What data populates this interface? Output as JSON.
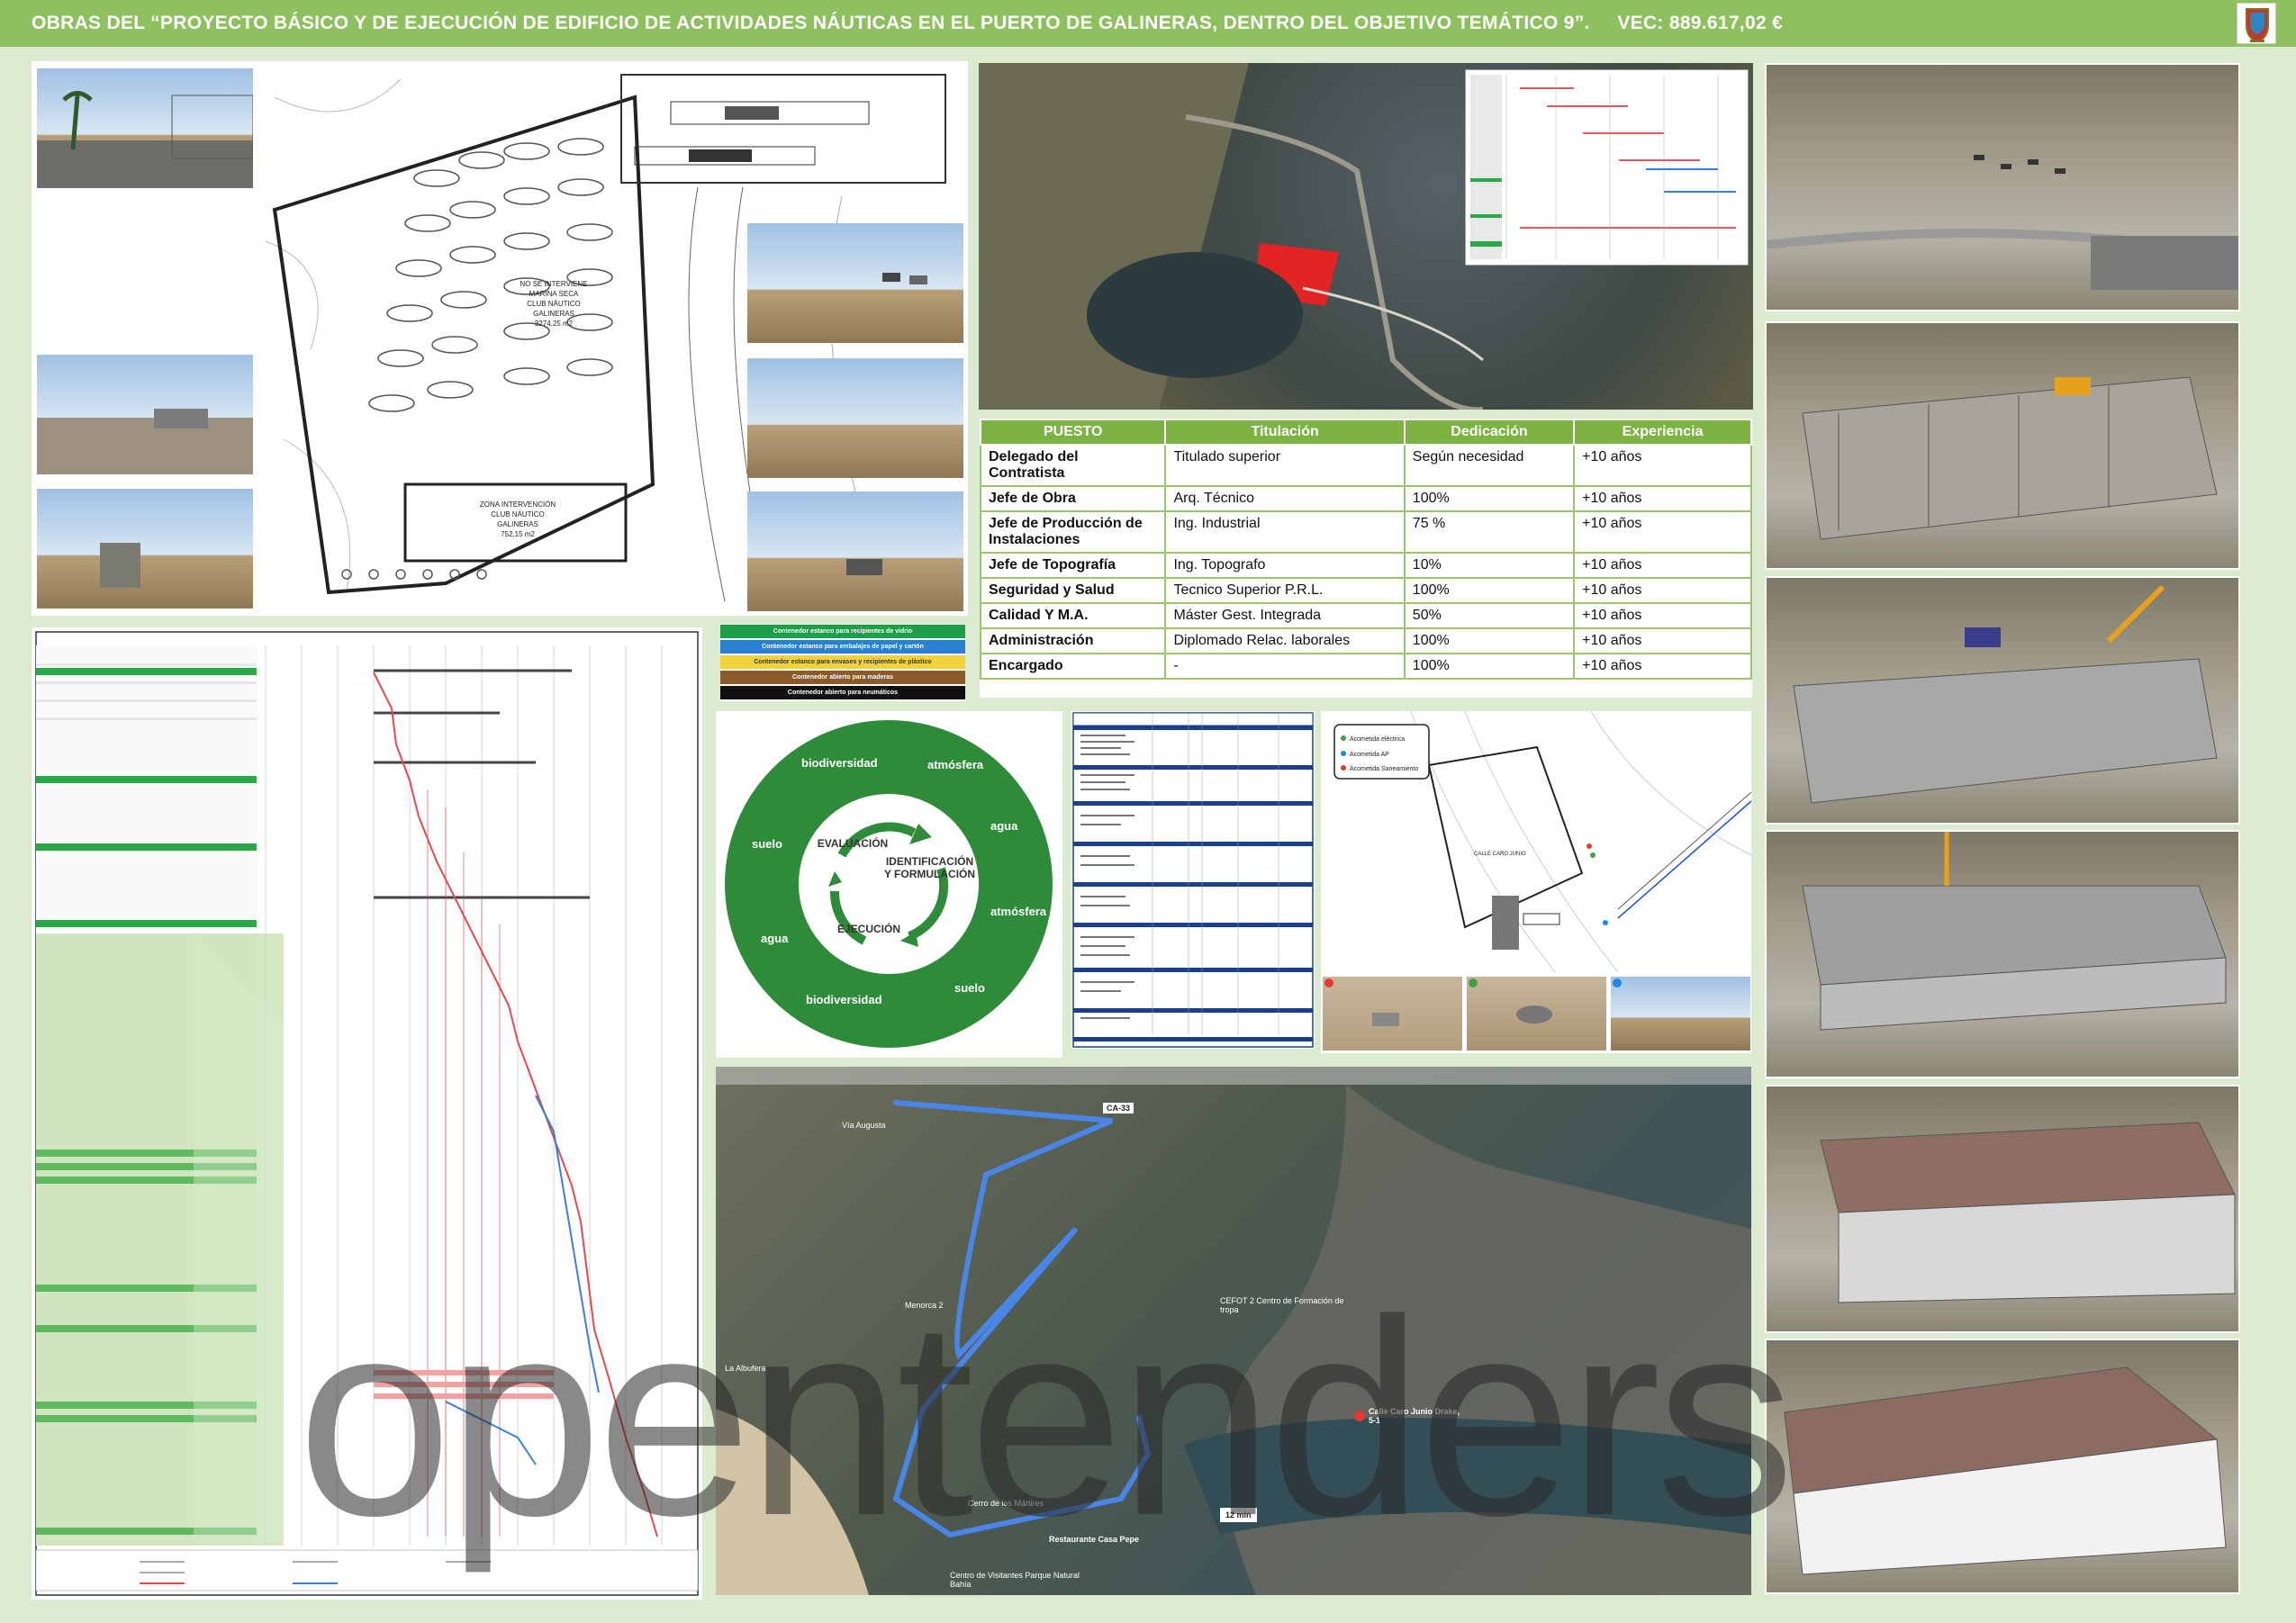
{
  "header": {
    "title": "OBRAS DEL “PROYECTO BÁSICO Y DE EJECUCIÓN DE EDIFICIO DE ACTIVIDADES NÁUTICAS EN EL PUERTO DE GALINERAS, DENTRO DEL OBJETIVO TEMÁTICO 9”.",
    "vec": "VEC: 889.617,02 €"
  },
  "plan": {
    "note1": "NO SE INTERVIENE",
    "note2": "MARINA SECA",
    "note3": "CLUB NÁUTICO",
    "note4": "GALINERAS",
    "note5": "3274,25 m2",
    "zone1": "ZONA INTERVENCIÓN",
    "zone2": "CLUB NÁUTICO",
    "zone3": "GALINERAS",
    "zone4": "752,15 m2"
  },
  "staff_table": {
    "headers": [
      "PUESTO",
      "Titulación",
      "Dedicación",
      "Experiencia"
    ],
    "rows": [
      [
        "Delegado del Contratista",
        "Titulado superior",
        "Según necesidad",
        "+10 años"
      ],
      [
        "Jefe de Obra",
        "Arq. Técnico",
        "100%",
        "+10 años"
      ],
      [
        "Jefe de Producción de Instalaciones",
        "Ing. Industrial",
        "75 %",
        "+10 años"
      ],
      [
        "Jefe de Topografía",
        "Ing. Topografo",
        "10%",
        "+10 años"
      ],
      [
        "Seguridad y Salud",
        "Tecnico Superior P.R.L.",
        "100%",
        "+10 años"
      ],
      [
        "Calidad Y M.A.",
        "Máster Gest. Integrada",
        "50%",
        "+10 años"
      ],
      [
        "Administración",
        "Diplomado Relac. laborales",
        "100%",
        "+10 años"
      ],
      [
        "Encargado",
        "-",
        "100%",
        "+10 años"
      ]
    ]
  },
  "waste_legend": [
    {
      "label": "Contenedor estanco para recipientes de vidrio",
      "color": "#1e9e4a",
      "text_color": "#ffffff"
    },
    {
      "label": "Contenedor estanco para embalajes de papel y cartón",
      "color": "#2a7fd0",
      "text_color": "#ffffff"
    },
    {
      "label": "Contenedor estanco para envases y recipientes de plástico",
      "color": "#f2d23a",
      "text_color": "#333333"
    },
    {
      "label": "Contenedor abierto para maderas",
      "color": "#8a5a2b",
      "text_color": "#ffffff"
    },
    {
      "label": "Contenedor abierto para neumáticos",
      "color": "#111111",
      "text_color": "#ffffff"
    }
  ],
  "env_wheel": {
    "outer": [
      "biodiversidad",
      "atmósfera",
      "agua",
      "atmósfera",
      "suelo",
      "biodiversidad",
      "agua",
      "suelo"
    ],
    "inner": [
      "EVALUACIÓN",
      "IDENTIFICACIÓN Y FORMULACIÓN",
      "EJECUCIÓN"
    ],
    "color": "#2e8b3a"
  },
  "utility_legend": [
    "Acometida eléctrica",
    "Acometida AP",
    "Acometida Saneamiento"
  ],
  "utility_plan_label": "CALLE CARO JUNIO",
  "map": {
    "labels": [
      "CA-33",
      "La Albufera",
      "Calle Caro Junio Drake, 5-1",
      "Restaurante Casa Pepe",
      "CEFOT 2 Centro de Formación de tropa",
      "Cerro de los Mártires",
      "Centro de Visitantes Parque Natural Bahía",
      "Vía Augusta",
      "Menorca 2"
    ],
    "route_time": "12 min"
  },
  "watermark": "opentenders"
}
